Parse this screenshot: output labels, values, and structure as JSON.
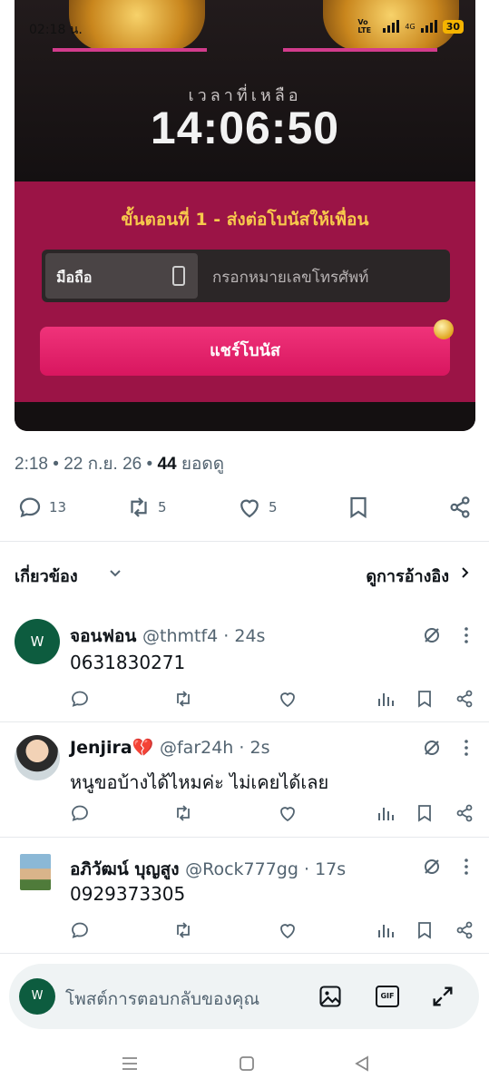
{
  "status_bar": {
    "time": "02:18 น.",
    "battery": "30",
    "net1": "Vo LTE",
    "net2": "4G"
  },
  "promo": {
    "remaining_label": "เวลาที่เหลือ",
    "timer": "14:06:50",
    "step_title": "ขั้นตอนที่ 1 - ส่งต่อโบนัสให้เพื่อน",
    "phone_tag": "มือถือ",
    "phone_placeholder": "กรอกหมายเลขโทรศัพท์",
    "share_button": "แชร์โบนัส"
  },
  "tweet": {
    "time": "2:18",
    "date": "22 ก.ย. 26",
    "views_count": "44",
    "views_label": "ยอดดู",
    "replies": "13",
    "reposts": "5",
    "likes": "5"
  },
  "section": {
    "related": "เกี่ยวข้อง",
    "quotes": "ดูการอ้างอิง"
  },
  "replies": [
    {
      "name": "จอนฟอน",
      "handle": "@thmtf4",
      "age": "24s",
      "text": "0631830271",
      "avatar_letter": "W"
    },
    {
      "name": "Jenjira💔",
      "handle": "@far24h",
      "age": "2s",
      "text": "หนูขอบ้างได้ไหมค่ะ ไม่เคยได้เลย"
    },
    {
      "name": "อภิวัฒน์ บุญสูง",
      "handle": "@Rock777gg",
      "age": "17s",
      "text": "0929373305"
    }
  ],
  "composer": {
    "avatar_letter": "W",
    "placeholder": "โพสต์การตอบกลับของคุณ",
    "gif_label": "GIF"
  },
  "colors": {
    "accent_pink": "#d8165f",
    "card_pink": "#9b1446",
    "avatar_green": "#0d5c3f",
    "muted": "#536471"
  }
}
